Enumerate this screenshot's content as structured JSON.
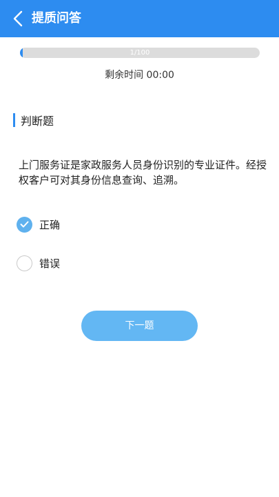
{
  "header": {
    "title": "提质问答",
    "back_icon": "chevron-left-icon"
  },
  "progress": {
    "current": 1,
    "total": 100,
    "text": "1/100",
    "fraction": 0.01
  },
  "timer": {
    "text": "剩余时间 00:00"
  },
  "question": {
    "type_label": "判断题",
    "text": "上门服务证是家政服务人员身份识别的专业证件。经授权客户可对其身份信息查询、追溯。",
    "options": [
      {
        "label": "正确",
        "selected": true
      },
      {
        "label": "错误",
        "selected": false
      }
    ]
  },
  "actions": {
    "next_label": "下一题"
  },
  "colors": {
    "primary": "#2d8cf0",
    "radio_checked": "#5fb1ee",
    "button": "#63b7f3",
    "track": "#dcdcdc"
  }
}
